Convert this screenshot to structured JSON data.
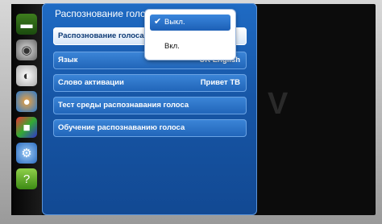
{
  "panel_title": "Распознование голоса",
  "menu": [
    {
      "label": "Распознование голоса",
      "value": ""
    },
    {
      "label": "Язык",
      "value": "UK English"
    },
    {
      "label": "Слово активации",
      "value": "Привет ТВ"
    },
    {
      "label": "Тест среды распознавания голоса",
      "value": ""
    },
    {
      "label": "Обучение распознаванию голоса",
      "value": ""
    }
  ],
  "popup": {
    "options": [
      "Выкл.",
      "Вкл."
    ],
    "selected": "Выкл."
  },
  "icons": [
    "picture-icon",
    "sound-icon",
    "broadcast-icon",
    "network-icon",
    "smart-features-icon",
    "system-gear-icon",
    "support-icon"
  ]
}
